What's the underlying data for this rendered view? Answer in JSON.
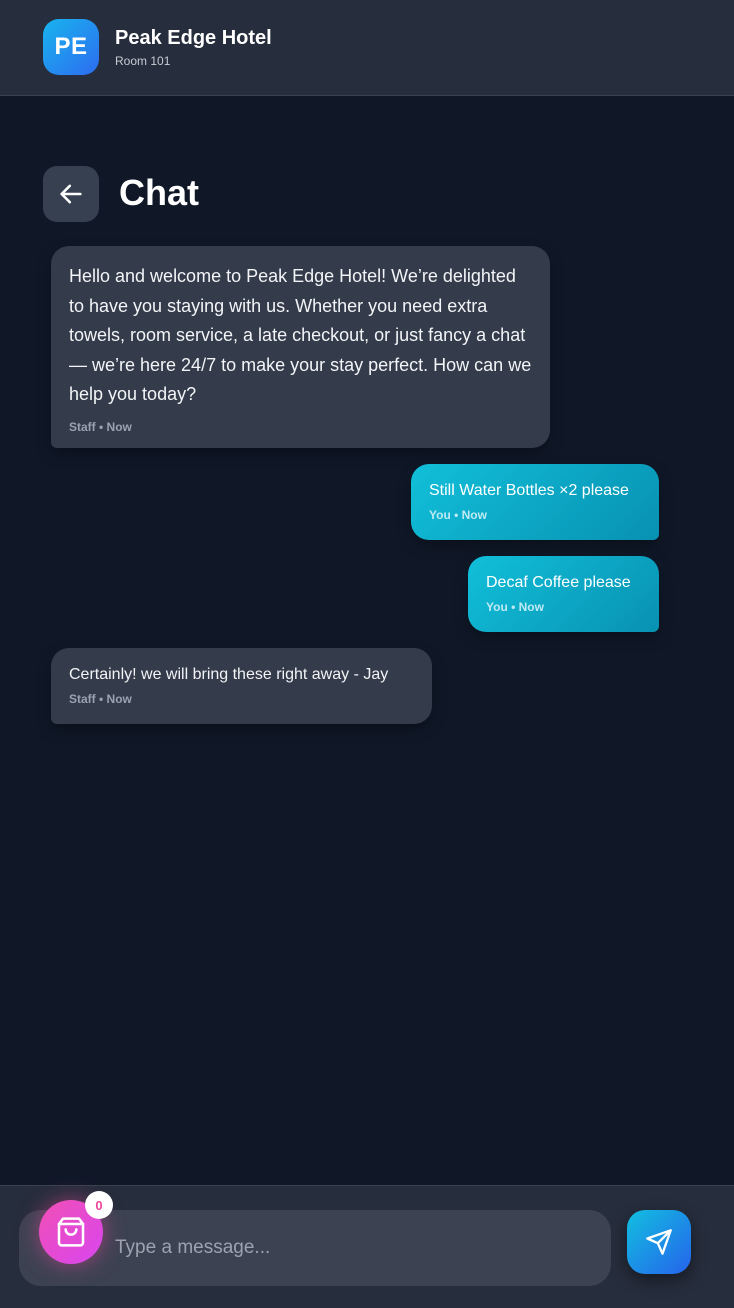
{
  "header": {
    "logo_initials": "PE",
    "hotel_name": "Peak Edge Hotel",
    "room": "Room 101"
  },
  "page": {
    "title": "Chat",
    "back_icon": "arrow-left-icon"
  },
  "messages": [
    {
      "sender": "staff",
      "text": "Hello and welcome to Peak Edge Hotel! We’re delighted to have you staying with us. Whether you need extra towels, room service, a late checkout, or just fancy a chat — we’re here 24/7 to make your stay perfect. How can we help you today?",
      "meta": "Staff • Now"
    },
    {
      "sender": "you",
      "text": "Still Water Bottles ×2 please",
      "meta": "You • Now"
    },
    {
      "sender": "you",
      "text": "Decaf Coffee please",
      "meta": "You • Now"
    },
    {
      "sender": "staff",
      "text": "Certainly! we will bring these right away - Jay",
      "meta": "Staff • Now"
    }
  ],
  "composer": {
    "placeholder": "Type a message...",
    "value": "",
    "cart_icon": "shopping-bag-icon",
    "cart_count": "0",
    "send_icon": "send-icon"
  },
  "colors": {
    "background": "#101828",
    "header": "#262d3c",
    "staff_bubble": "#343b4a",
    "you_bubble": "#0891b2",
    "cart_accent": "#ec4899",
    "send_accent": "#2563eb"
  }
}
